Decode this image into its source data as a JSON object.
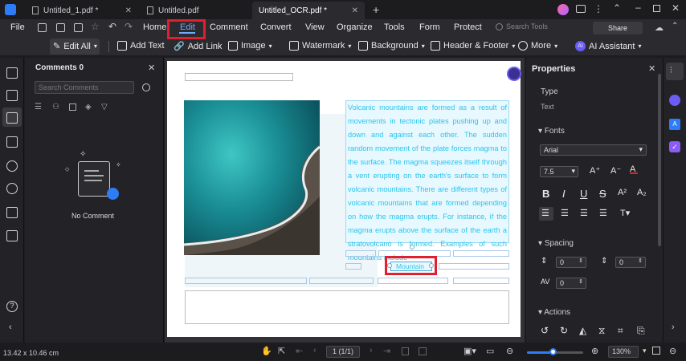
{
  "tabs": [
    {
      "label": "Untitled_1.pdf *"
    },
    {
      "label": "Untitled.pdf"
    },
    {
      "label": "Untitled_OCR.pdf *"
    }
  ],
  "menu": {
    "file": "File",
    "items": [
      "Home",
      "Edit",
      "Comment",
      "Convert",
      "View",
      "Organize",
      "Tools",
      "Form",
      "Protect"
    ],
    "active": "Edit",
    "search_placeholder": "Search Tools",
    "share": "Share"
  },
  "toolbar": {
    "edit_all": "Edit All",
    "add_text": "Add Text",
    "add_link": "Add Link",
    "image": "Image",
    "watermark": "Watermark",
    "background": "Background",
    "header_footer": "Header & Footer",
    "more": "More",
    "ai_assistant": "AI Assistant"
  },
  "comments": {
    "title": "Comments 0",
    "search_placeholder": "Search Comments",
    "empty": "No Comment"
  },
  "document": {
    "paragraph": "Volcanic mountains are formed as a result of movements in tectonic plates pushing up and down and against each other. The sudden random movement of the plate forces magma to the surface. The magma squeezes itself through a vent erupting on the earth's surface to form volcanic mountains. There are different types of volcanic mountains that are formed depending on how the magma erupts. For instance, if the magma erupts above the surface of the earth a stratovolcano is formed. Examples of such mountains include",
    "caption": "Mountain"
  },
  "properties": {
    "title": "Properties",
    "type_label": "Type",
    "type_value": "Text",
    "fonts_label": "Fonts",
    "font_family": "Arial",
    "font_size": "7.5",
    "spacing_label": "Spacing",
    "line_spacing": "0",
    "para_spacing": "0",
    "char_spacing": "0",
    "actions_label": "Actions"
  },
  "status": {
    "dimensions": "13.42 x 10.46 cm",
    "page": "1 (1/1)",
    "zoom": "130%",
    "zoom_fraction": 0.45
  },
  "colors": {
    "accent": "#2e7cf6",
    "highlight_box": "#e02030",
    "ocr_text": "#29c5ec"
  }
}
